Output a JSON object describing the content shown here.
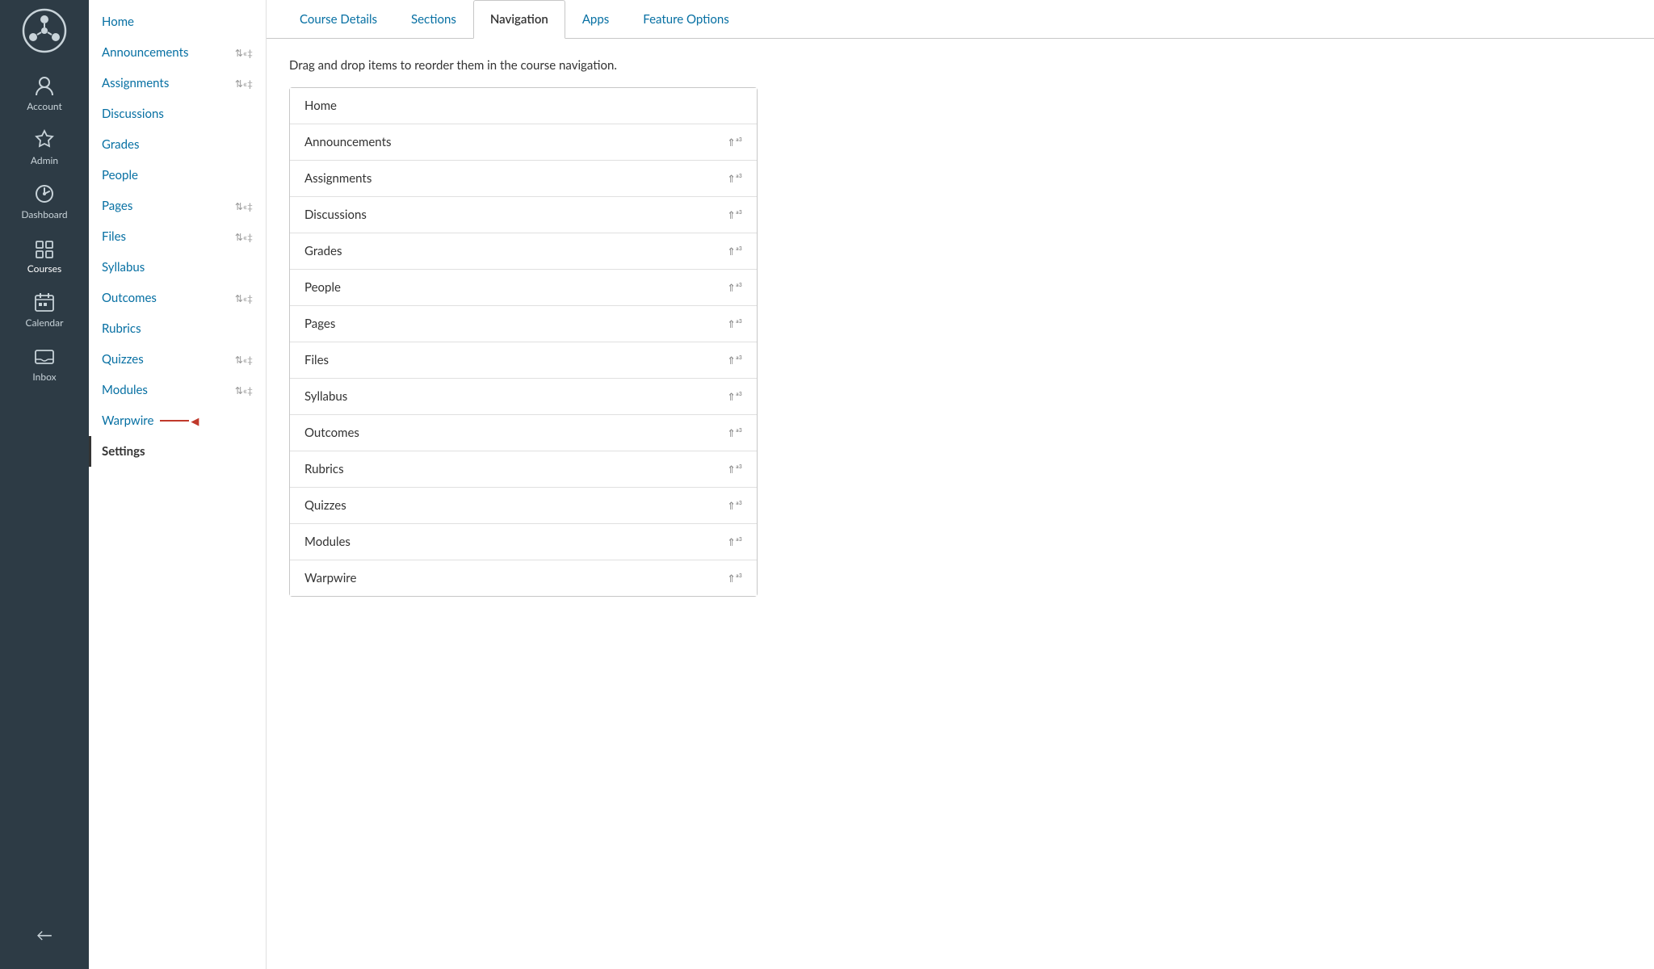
{
  "global_nav": {
    "items": [
      {
        "id": "account",
        "label": "Account",
        "icon": "account-icon"
      },
      {
        "id": "admin",
        "label": "Admin",
        "icon": "admin-icon"
      },
      {
        "id": "dashboard",
        "label": "Dashboard",
        "icon": "dashboard-icon"
      },
      {
        "id": "courses",
        "label": "Courses",
        "icon": "courses-icon"
      },
      {
        "id": "calendar",
        "label": "Calendar",
        "icon": "calendar-icon"
      },
      {
        "id": "inbox",
        "label": "Inbox",
        "icon": "inbox-icon"
      }
    ],
    "collapse_label": "←"
  },
  "course_nav": {
    "items": [
      {
        "id": "home",
        "label": "Home",
        "has_drag": false
      },
      {
        "id": "announcements",
        "label": "Announcements",
        "has_drag": true
      },
      {
        "id": "assignments",
        "label": "Assignments",
        "has_drag": true
      },
      {
        "id": "discussions",
        "label": "Discussions",
        "has_drag": false
      },
      {
        "id": "grades",
        "label": "Grades",
        "has_drag": false
      },
      {
        "id": "people",
        "label": "People",
        "has_drag": false
      },
      {
        "id": "pages",
        "label": "Pages",
        "has_drag": true
      },
      {
        "id": "files",
        "label": "Files",
        "has_drag": true
      },
      {
        "id": "syllabus",
        "label": "Syllabus",
        "has_drag": false
      },
      {
        "id": "outcomes",
        "label": "Outcomes",
        "has_drag": true
      },
      {
        "id": "rubrics",
        "label": "Rubrics",
        "has_drag": false
      },
      {
        "id": "quizzes",
        "label": "Quizzes",
        "has_drag": true
      },
      {
        "id": "modules",
        "label": "Modules",
        "has_drag": true
      },
      {
        "id": "warpwire",
        "label": "Warpwire",
        "has_drag": false,
        "has_arrow": true
      },
      {
        "id": "settings",
        "label": "Settings",
        "has_drag": false,
        "is_active": true
      }
    ],
    "drag_icon": "⇅«‡"
  },
  "tabs": [
    {
      "id": "course-details",
      "label": "Course Details",
      "active": false
    },
    {
      "id": "sections",
      "label": "Sections",
      "active": false
    },
    {
      "id": "navigation",
      "label": "Navigation",
      "active": true
    },
    {
      "id": "apps",
      "label": "Apps",
      "active": false
    },
    {
      "id": "feature-options",
      "label": "Feature Options",
      "active": false
    }
  ],
  "content": {
    "description": "Drag and drop items to reorder them in the course navigation.",
    "nav_items": [
      {
        "id": "home",
        "label": "Home",
        "has_icon": false
      },
      {
        "id": "announcements",
        "label": "Announcements",
        "has_icon": true
      },
      {
        "id": "assignments",
        "label": "Assignments",
        "has_icon": true
      },
      {
        "id": "discussions",
        "label": "Discussions",
        "has_icon": true
      },
      {
        "id": "grades",
        "label": "Grades",
        "has_icon": true
      },
      {
        "id": "people",
        "label": "People",
        "has_icon": true
      },
      {
        "id": "pages",
        "label": "Pages",
        "has_icon": true
      },
      {
        "id": "files",
        "label": "Files",
        "has_icon": true
      },
      {
        "id": "syllabus",
        "label": "Syllabus",
        "has_icon": true
      },
      {
        "id": "outcomes",
        "label": "Outcomes",
        "has_icon": true
      },
      {
        "id": "rubrics",
        "label": "Rubrics",
        "has_icon": true
      },
      {
        "id": "quizzes",
        "label": "Quizzes",
        "has_icon": true
      },
      {
        "id": "modules",
        "label": "Modules",
        "has_icon": true
      },
      {
        "id": "warpwire",
        "label": "Warpwire",
        "has_icon": true
      }
    ],
    "drag_icon_unicode": "⇑ª³"
  },
  "colors": {
    "accent": "#0770a3",
    "active_tab": "#333",
    "sidebar_bg": "#2d3b45",
    "arrow_color": "#c0392b"
  }
}
